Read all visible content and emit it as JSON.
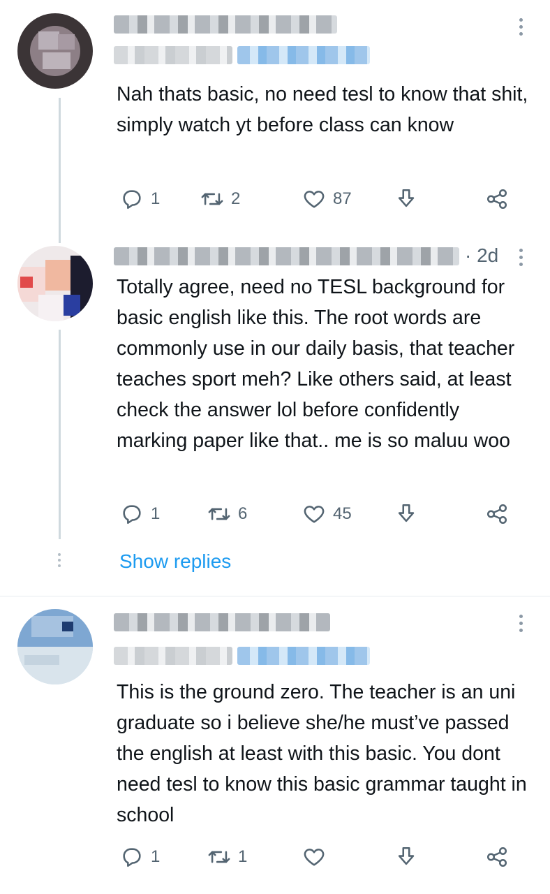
{
  "tweets": [
    {
      "text": "Nah thats basic, no need tesl to know that shit, simply watch yt before class can know",
      "replies": "1",
      "retweets": "2",
      "likes": "87"
    },
    {
      "timestamp": "· 2d",
      "text": "Totally agree, need no TESL background for basic english like this. The root words are commonly use in our daily basis, that teacher teaches sport meh? Like others said, at least check the answer lol before confidently marking paper like that.. me is so maluu woo",
      "replies": "1",
      "retweets": "6",
      "likes": "45"
    },
    {
      "text": "This is the ground zero. The teacher is an uni graduate so i believe she/he must’ve passed the english at least with this basic. You dont need tesl to know this basic grammar taught in school",
      "replies": "1",
      "retweets": "1",
      "likes": ""
    }
  ],
  "thread": {
    "show_replies_label": "Show replies"
  },
  "icons": {
    "reply": "reply-icon",
    "retweet": "retweet-icon",
    "like": "heart-icon",
    "bookmark": "bookmark-download-icon",
    "share": "share-icon",
    "more": "more-vertical-icon"
  },
  "colors": {
    "link": "#1d9bf0",
    "icon_gray": "#536471",
    "thread_line": "#cfd9de"
  }
}
